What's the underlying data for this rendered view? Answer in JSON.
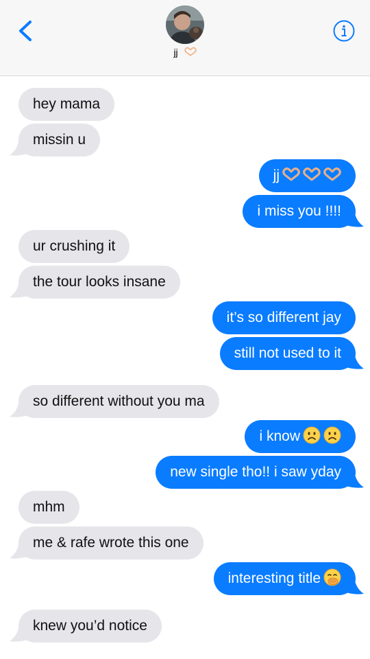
{
  "header": {
    "contact_name": "jj",
    "contact_name_emoji": "heart-hands-emoji",
    "back_icon": "chevron-left-icon",
    "info_icon": "info-icon"
  },
  "colors": {
    "accent": "#0a7cff",
    "incoming_bubble": "#e5e5ea",
    "header_bg": "#f7f7f7"
  },
  "messages": [
    {
      "dir": "in",
      "text": "hey mama"
    },
    {
      "dir": "in",
      "text": "missin u"
    },
    {
      "dir": "out",
      "text": "jj",
      "emoji": [
        "heart-hands-emoji",
        "heart-hands-emoji",
        "heart-hands-emoji"
      ]
    },
    {
      "dir": "out",
      "text": "i miss you !!!!"
    },
    {
      "dir": "in",
      "text": "ur crushing it"
    },
    {
      "dir": "in",
      "text": "the tour looks insane"
    },
    {
      "dir": "out",
      "text": "it’s so different jay"
    },
    {
      "dir": "out",
      "text": "still not used to it"
    },
    {
      "dir": "in",
      "text": "so different without you ma"
    },
    {
      "dir": "out",
      "text": "i know",
      "emoji": [
        "frowning-face-emoji",
        "frowning-face-emoji"
      ]
    },
    {
      "dir": "out",
      "text": "new single tho!! i saw yday"
    },
    {
      "dir": "in",
      "text": "mhm"
    },
    {
      "dir": "in",
      "text": "me & rafe wrote this one"
    },
    {
      "dir": "out",
      "text": "interesting title",
      "emoji": [
        "hand-over-mouth-emoji"
      ]
    },
    {
      "dir": "in",
      "text": "knew you’d notice"
    }
  ]
}
